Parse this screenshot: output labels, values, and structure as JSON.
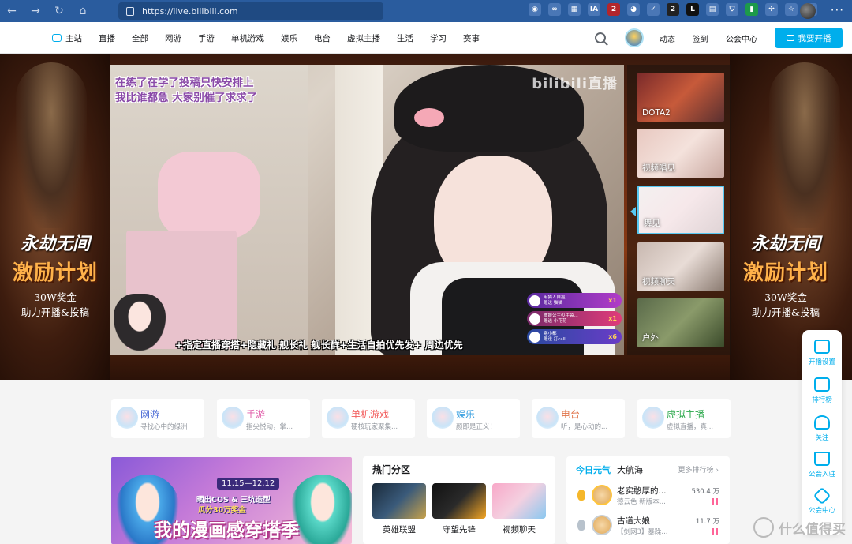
{
  "browser": {
    "url": "https://live.bilibili.com",
    "ext_badges": [
      "IA",
      "2",
      "1",
      "2",
      "L"
    ],
    "menu": "···"
  },
  "header": {
    "nav": [
      "主站",
      "直播",
      "全部",
      "网游",
      "手游",
      "单机游戏",
      "娱乐",
      "电台",
      "虚拟主播",
      "生活",
      "学习",
      "赛事"
    ],
    "right": [
      "动态",
      "签到",
      "公会中心"
    ],
    "start_button": "我要开播"
  },
  "banner": {
    "promo_logo": "永劫无间",
    "promo_title": "激励计划",
    "promo_line1": "30W奖金",
    "promo_line2": "助力开播&投稿",
    "overlay_line1": "在练了在学了投稿只快安排上",
    "overlay_line2": "我比谁都急 大家别催了求求了",
    "watermark": "bilibili直播",
    "caption": "+指定直播穿搭+隐藏礼 舰长礼 舰长群+生活自拍优先发+ 周边优先",
    "gifts": [
      {
        "user": "用猫人自抠",
        "desc": "赠送 猫猫",
        "count": "x1"
      },
      {
        "user": "撒娇公主の手袋...",
        "desc": "赠送 小花花",
        "count": "x1"
      },
      {
        "user": "寒小都",
        "desc": "赠送 打call",
        "count": "x6"
      }
    ],
    "thumbs": [
      "DOTA2",
      "视频唱见",
      "舞见",
      "视频聊天",
      "户外"
    ]
  },
  "categories": [
    {
      "title": "网游",
      "sub": "寻找心中的绿洲",
      "color": "#4b6bd6"
    },
    {
      "title": "手游",
      "sub": "指尖悦动，掌...",
      "color": "#e05aa8"
    },
    {
      "title": "单机游戏",
      "sub": "硬核玩家聚集...",
      "color": "#f25d5d"
    },
    {
      "title": "娱乐",
      "sub": "颜即是正义！",
      "color": "#3aa0e0"
    },
    {
      "title": "电台",
      "sub": "听，是心动的...",
      "color": "#e0744a"
    },
    {
      "title": "虚拟主播",
      "sub": "虚拟直播，真...",
      "color": "#2aa84a"
    }
  ],
  "promo_banner": {
    "date": "11.15—12.12",
    "line1": "晒出COS & 三坑造型",
    "line2": "瓜分30万奖金",
    "title": "我的漫画感穿搭季"
  },
  "hot": {
    "title": "热门分区",
    "items": [
      "英雄联盟",
      "守望先锋",
      "视频聊天"
    ]
  },
  "rank": {
    "tab_active": "今日元气",
    "tab_other": "大航海",
    "more": "更多排行榜 ›",
    "rows": [
      {
        "name": "老实憨厚的...",
        "sub": "德云色 新版本...",
        "pop": "530.4 万"
      },
      {
        "name": "古道大娘",
        "sub": "【剑网3】暴躁...",
        "pop": "11.7 万"
      }
    ]
  },
  "float_bar": [
    "开播设置",
    "排行榜",
    "关注",
    "公会入驻",
    "公会中心"
  ],
  "site_watermark": "什么值得买"
}
